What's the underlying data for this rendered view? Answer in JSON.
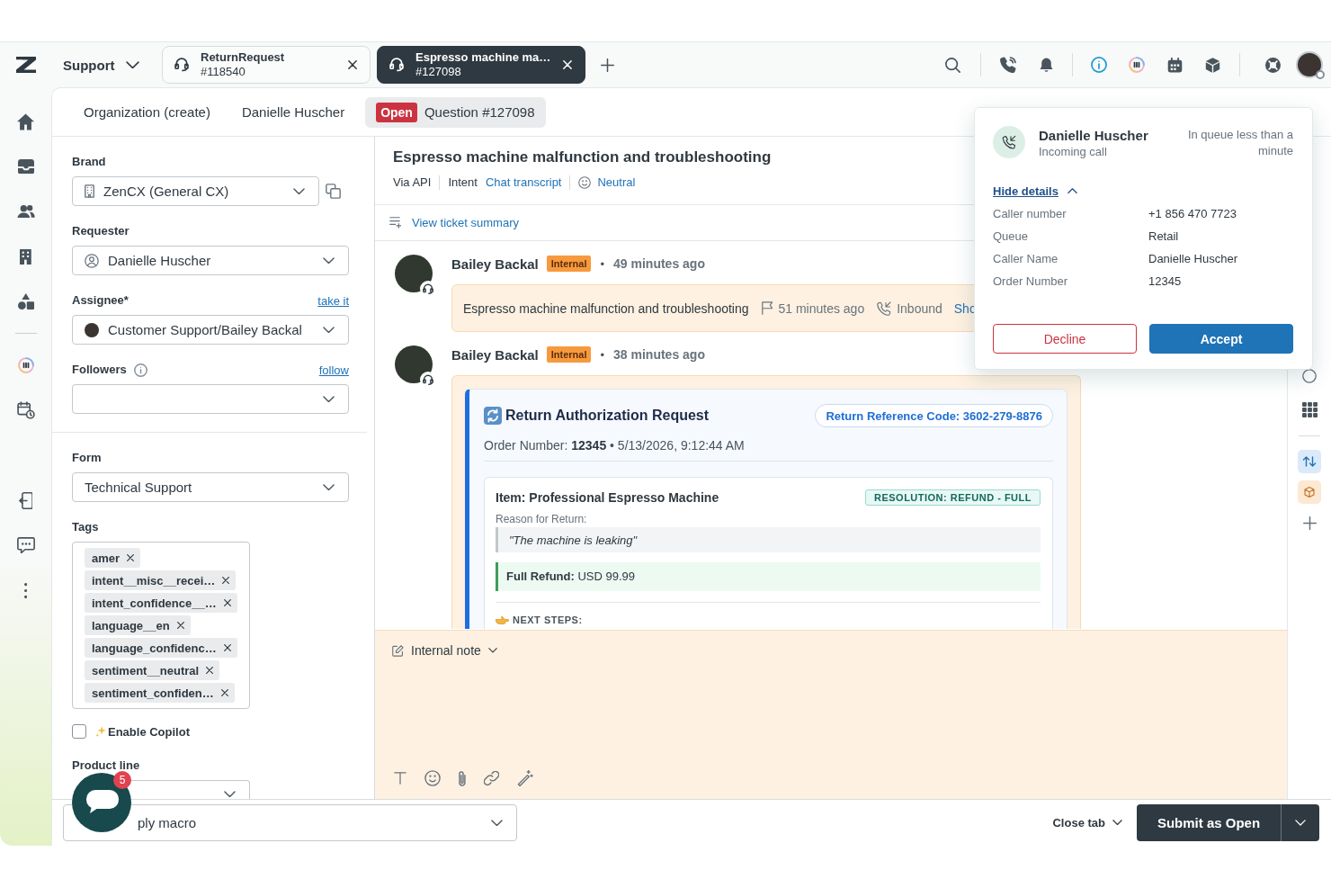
{
  "topbar": {
    "product": "Support",
    "tabs": [
      {
        "title": "ReturnRequest",
        "number": "#118540",
        "selected": false
      },
      {
        "title": "Espresso machine ma…",
        "number": "#127098",
        "selected": true
      }
    ]
  },
  "subtabs": [
    {
      "label": "Organization (create)",
      "selected": false
    },
    {
      "label": "Danielle Huscher",
      "selected": false
    },
    {
      "status": "Open",
      "label": "Question #127098",
      "selected": true
    }
  ],
  "form": {
    "brand": {
      "label": "Brand",
      "value": "ZenCX (General CX)"
    },
    "requester": {
      "label": "Requester",
      "value": "Danielle Huscher"
    },
    "assignee": {
      "label": "Assignee*",
      "link": "take it",
      "value": "Customer Support/Bailey Backal"
    },
    "followers": {
      "label": "Followers",
      "link": "follow"
    },
    "ticket_form": {
      "label": "Form",
      "value": "Technical Support"
    },
    "tags": {
      "label": "Tags",
      "items": [
        "amer",
        "intent__misc__recei…",
        "intent_confidence__…",
        "language__en",
        "language_confidenc…",
        "sentiment__neutral",
        "sentiment_confiden…"
      ]
    },
    "copilot": {
      "label": "Enable Copilot",
      "checked": false
    },
    "product_line": {
      "label": "Product line"
    }
  },
  "ticket": {
    "title": "Espresso machine malfunction and troubleshooting",
    "channel": "Via API",
    "intent_label": "Intent",
    "intent": "Chat transcript",
    "sentiment": "Neutral",
    "summary_link": "View ticket summary"
  },
  "messages": [
    {
      "kind": "call",
      "author": "Bailey Backal",
      "badge": "Internal",
      "separator": "•",
      "time": "49 minutes ago",
      "text": "Espresso machine malfunction and troubleshooting",
      "call_time": "51 minutes ago",
      "direction": "Inbound",
      "link": "Sho"
    },
    {
      "kind": "return_request",
      "author": "Bailey Backal",
      "badge": "Internal",
      "separator": "•",
      "time": "38 minutes ago",
      "title": "Return Authorization Request",
      "reference": "Return Reference Code: 3602-279-8876",
      "order": "Order Number: **12345** • 5/13/2026, 9:12:44 AM",
      "item": "Item: Professional Espresso Machine",
      "resolution": "RESOLUTION: REFUND - FULL",
      "reason_label": "Reason for Return:",
      "reason": "\"The machine is leaking\"",
      "refund": "**Full Refund:** USD 99.99",
      "next_steps": "NEXT STEPS:"
    }
  ],
  "composer": {
    "mode": "Internal note"
  },
  "footer": {
    "macro": {
      "placeholder": "ply macro"
    },
    "close_tab": "Close tab",
    "submit": "Submit as Open"
  },
  "chat_launcher": {
    "badge": "5"
  },
  "call_popup": {
    "caller": "Danielle Huscher",
    "subtitle": "Incoming call",
    "queue_time": "In queue less than a minute",
    "toggle": "Hide details",
    "expanded": true,
    "details": [
      {
        "label": "Caller number",
        "value": "+1 856 470 7723"
      },
      {
        "label": "Queue",
        "value": "Retail"
      },
      {
        "label": "Caller Name",
        "value": "Danielle Huscher"
      },
      {
        "label": "Order Number",
        "value": "12345"
      }
    ],
    "decline": "Decline",
    "accept": "Accept"
  }
}
